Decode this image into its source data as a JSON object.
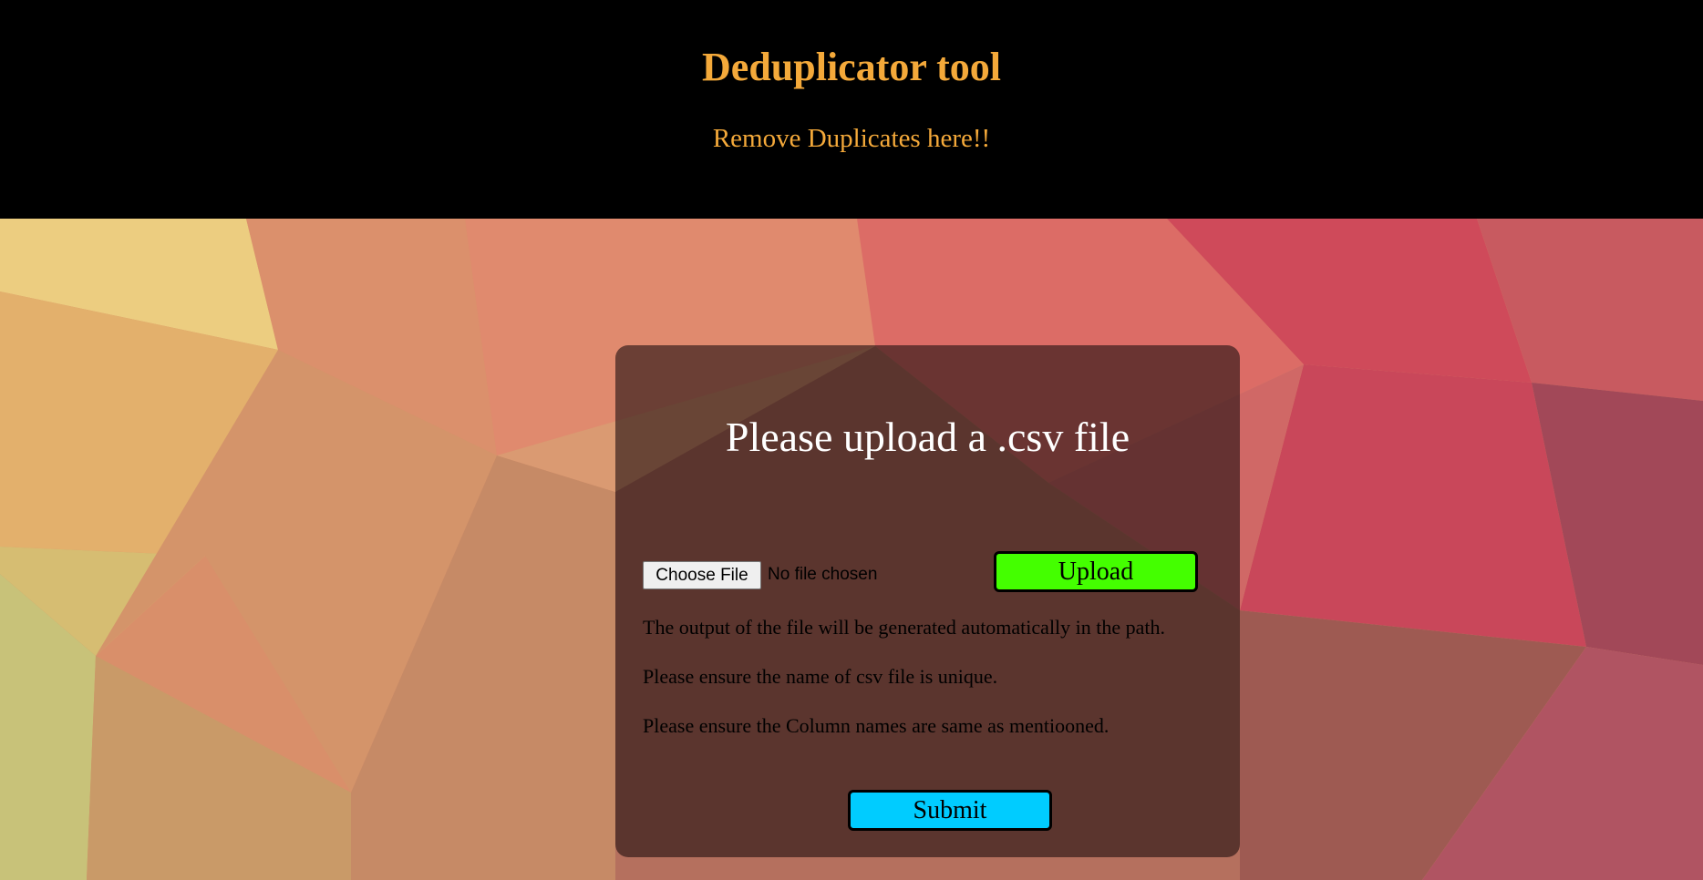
{
  "header": {
    "title": "Deduplicator tool",
    "subtitle": "Remove Duplicates here!!"
  },
  "card": {
    "title": "Please upload a .csv file",
    "choose_file_label": "Choose File",
    "file_status": "No file chosen",
    "upload_label": "Upload",
    "notes": [
      "The output of the file will be generated automatically in the path.",
      "Please ensure the name of csv file is unique.",
      "Please ensure the Column names are same as mentiooned."
    ],
    "submit_label": "Submit"
  },
  "colors": {
    "header_bg": "#000000",
    "header_text": "#f4a93a",
    "upload_button": "#44ff00",
    "submit_button": "#00ccff",
    "card_overlay": "rgba(35,18,18,0.62)"
  }
}
